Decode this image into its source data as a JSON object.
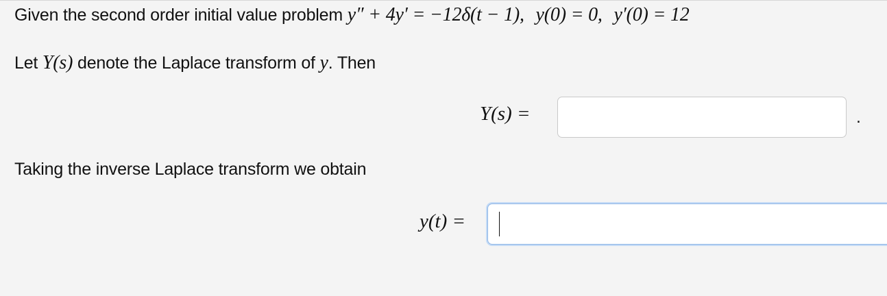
{
  "problem": {
    "intro": "Given the second order initial value problem",
    "equation": {
      "ode": "y″ + 4y′ = −12δ(t − 1),",
      "ic1": "y(0) = 0,",
      "ic2": "y′(0) = 12"
    }
  },
  "let_line": {
    "prefix": "Let",
    "Ys": "Y(s)",
    "middle": "denote the Laplace transform of",
    "y": "y",
    "suffix": ". Then"
  },
  "laplace_answer": {
    "label": "Y(s) =",
    "value": "",
    "trailing": "."
  },
  "taking_line": "Taking the inverse Laplace transform we obtain",
  "inverse_answer": {
    "label": "y(t) =",
    "value": ""
  }
}
